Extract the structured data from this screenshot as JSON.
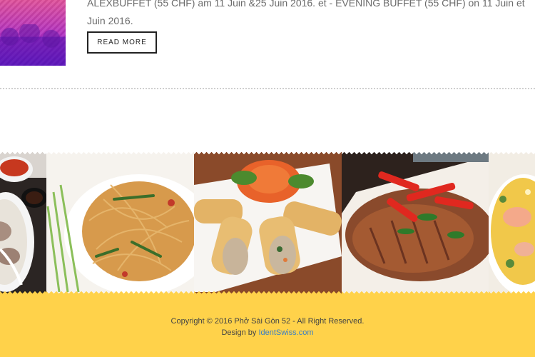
{
  "post": {
    "text_line1": "ALEXBUFFET (55 CHF) am 11 Juin &25 Juin 2016. et - EVENING BUFFET (55 CHF) on 11 Juin et",
    "text_line2": "Juin 2016.",
    "read_more_label": "READ MORE"
  },
  "gallery": {
    "images": [
      "Pho bowl",
      "Pad thai noodles",
      "Spring rolls",
      "Fried fish with chili",
      "Fried rice with shrimp"
    ]
  },
  "footer": {
    "copyright": "Copyright © 2016 Phở Sài Gòn 52 - All Right Reserved.",
    "design_prefix": "Design by ",
    "design_link": "IdentSwiss.com"
  },
  "colors": {
    "footer_bg": "#ffd24a",
    "link": "#3b7fc4"
  }
}
